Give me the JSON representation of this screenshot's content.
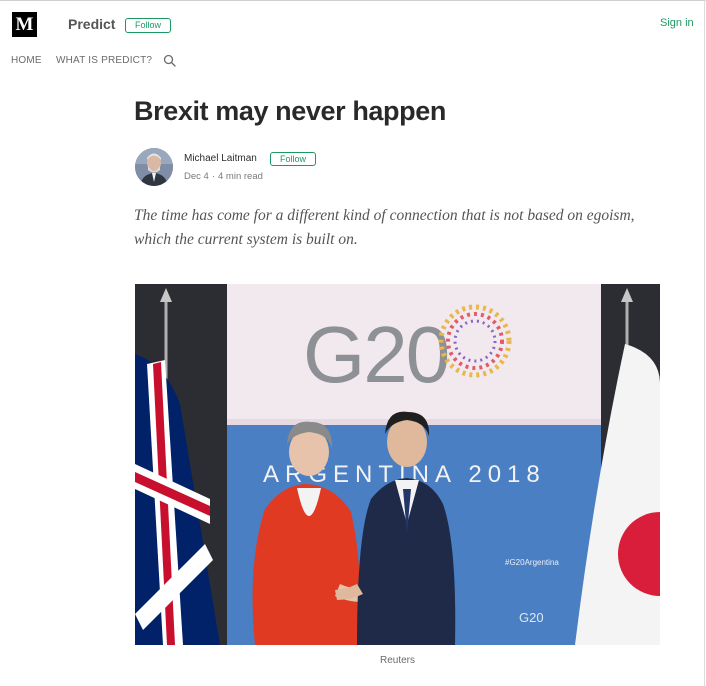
{
  "header": {
    "logo_text": "M",
    "publication": "Predict",
    "follow_label": "Follow",
    "signin_label": "Sign in"
  },
  "nav": {
    "items": [
      "HOME",
      "WHAT IS PREDICT?"
    ],
    "search_icon": "search-icon"
  },
  "article": {
    "title": "Brexit may never happen",
    "author": "Michael Laitman",
    "author_follow_label": "Follow",
    "date": "Dec 4",
    "read_time": "4 min read",
    "subtitle": "The time has come for a different kind of connection that is not based on egoism, which the current system is built on.",
    "image": {
      "backdrop_logo": "G20",
      "backdrop_banner": "ARGENTINA 2018",
      "backdrop_hashtag": "#G20Argentina",
      "caption": "Reuters"
    }
  },
  "colors": {
    "accent_green": "#1c9963",
    "backdrop_blue": "#4a7fc4",
    "flag_red": "#c8102e",
    "flag_blue": "#012169"
  }
}
